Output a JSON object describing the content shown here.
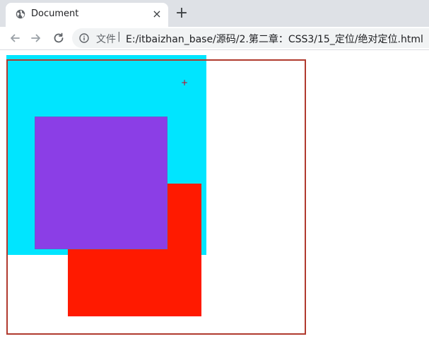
{
  "tab": {
    "title": "Document",
    "close_glyph": "×",
    "favicon": "globe-icon"
  },
  "tabstrip": {
    "new_tab_glyph": "+"
  },
  "toolbar": {
    "back_icon": "arrow-left-icon",
    "forward_icon": "arrow-right-icon",
    "reload_icon": "reload-icon"
  },
  "omnibox": {
    "info_icon": "info-icon",
    "scheme_label": "文件",
    "separator": "|",
    "url": "E:/itbaizhan_base/源码/2.第二章：CSS3/15_定位/绝对定位.html"
  },
  "page": {
    "cursor_glyph": "+",
    "colors": {
      "outer_border": "#b03a2e",
      "cyan": "#00e5ff",
      "purple": "#8b3ee6",
      "red": "#ff1a00"
    }
  }
}
